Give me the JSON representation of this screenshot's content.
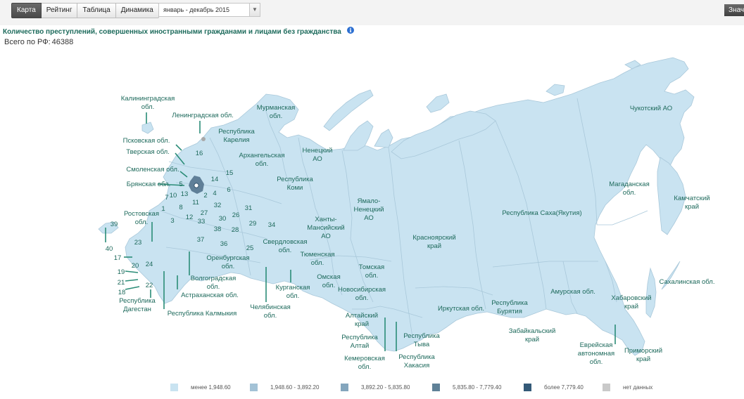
{
  "tabs": [
    {
      "label": "Карта",
      "active": true
    },
    {
      "label": "Рейтинг",
      "active": false
    },
    {
      "label": "Таблица",
      "active": false
    },
    {
      "label": "Динамика",
      "active": false
    }
  ],
  "period": {
    "value": "январь - декабрь 2015"
  },
  "right_button": {
    "label": "Значения"
  },
  "title": "Количество преступлений, совершенных иностранными гражданами и лицами без гражданства",
  "total": {
    "label": "Всего по РФ:",
    "value": "46388"
  },
  "legend": [
    {
      "label": "менее 1,948.60",
      "color": "#c9e3f1"
    },
    {
      "label": "1,948.60 - 3,892.20",
      "color": "#a3c2d6"
    },
    {
      "label": "3,892.20 - 5,835.80",
      "color": "#84a6bd"
    },
    {
      "label": "5,835.80 - 7,779.40",
      "color": "#5f8197"
    },
    {
      "label": "более 7,779.40",
      "color": "#345a78"
    },
    {
      "label": "нет данных",
      "color": "#c9c9c9"
    }
  ],
  "map": {
    "region_color": "#c9e3f1",
    "border_color": "#a9c8da",
    "label_color": "#1e6a5c",
    "moscow_color": "#5f7f98",
    "regions": [
      {
        "name": "Калининградская обл."
      },
      {
        "name": "Ленинградская обл."
      },
      {
        "name": "Мурманская обл."
      },
      {
        "name": "Республика Карелия"
      },
      {
        "name": "Псковская обл."
      },
      {
        "name": "Тверская обл."
      },
      {
        "name": "Смоленская обл."
      },
      {
        "name": "Брянская обл."
      },
      {
        "name": "Архангельская обл."
      },
      {
        "name": "Ненецкий АО"
      },
      {
        "name": "Республика Коми"
      },
      {
        "name": "Ямало-Ненецкий АО"
      },
      {
        "name": "Ханты-Мансийский АО"
      },
      {
        "name": "Свердловская обл."
      },
      {
        "name": "Тюменская обл."
      },
      {
        "name": "Оренбургская обл."
      },
      {
        "name": "Волгоградская обл."
      },
      {
        "name": "Астраханская обл."
      },
      {
        "name": "Республика Калмыкия"
      },
      {
        "name": "Республика Дагестан"
      },
      {
        "name": "Ростовская обл."
      },
      {
        "name": "Курганская обл."
      },
      {
        "name": "Челябинская обл."
      },
      {
        "name": "Омская обл."
      },
      {
        "name": "Томская обл."
      },
      {
        "name": "Новосибирская обл."
      },
      {
        "name": "Алтайский край"
      },
      {
        "name": "Республика Алтай"
      },
      {
        "name": "Кемеровская обл."
      },
      {
        "name": "Республика Тыва"
      },
      {
        "name": "Республика Хакасия"
      },
      {
        "name": "Красноярский край"
      },
      {
        "name": "Иркутская обл."
      },
      {
        "name": "Республика Бурятия"
      },
      {
        "name": "Забайкальский край"
      },
      {
        "name": "Республика Саха(Якутия)"
      },
      {
        "name": "Амурская обл."
      },
      {
        "name": "Еврейская автономная обл."
      },
      {
        "name": "Хабаровский край"
      },
      {
        "name": "Приморский край"
      },
      {
        "name": "Сахалинская обл."
      },
      {
        "name": "Магаданская обл."
      },
      {
        "name": "Камчатский край"
      },
      {
        "name": "Чукотский АО"
      }
    ],
    "numbers": [
      "1",
      "2",
      "3",
      "4",
      "5",
      "6",
      "7",
      "8",
      "10",
      "11",
      "12",
      "13",
      "14",
      "15",
      "16",
      "17",
      "18",
      "19",
      "20",
      "21",
      "22",
      "23",
      "24",
      "25",
      "26",
      "27",
      "28",
      "29",
      "30",
      "31",
      "32",
      "33",
      "34",
      "36",
      "37",
      "38",
      "39",
      "40"
    ]
  }
}
